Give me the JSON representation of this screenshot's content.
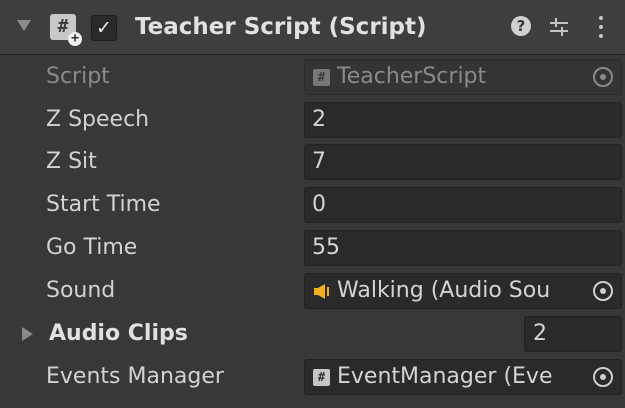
{
  "component": {
    "title": "Teacher Script (Script)",
    "enabled": true,
    "header_icons": [
      "script-icon",
      "help-icon",
      "preset-icon",
      "context-menu-icon"
    ]
  },
  "fields": {
    "script": {
      "label": "Script",
      "value": "TeacherScript",
      "icon": "script-asset-icon"
    },
    "z_speech": {
      "label": "Z Speech",
      "value": "2"
    },
    "z_sit": {
      "label": "Z Sit",
      "value": "7"
    },
    "start_time": {
      "label": "Start Time",
      "value": "0"
    },
    "go_time": {
      "label": "Go Time",
      "value": "55"
    },
    "sound": {
      "label": "Sound",
      "value": "Walking (Audio Sou",
      "icon": "audio-source-icon"
    },
    "audio_clips": {
      "label": "Audio Clips",
      "size": "2",
      "expanded": false
    },
    "events_manager": {
      "label": "Events Manager",
      "value": "EventManager (Eve",
      "icon": "script-asset-icon"
    }
  },
  "colors": {
    "background": "#383838",
    "header": "#3e3e3e",
    "field": "#2a2a2a",
    "audio_icon": "#f2b01e"
  }
}
